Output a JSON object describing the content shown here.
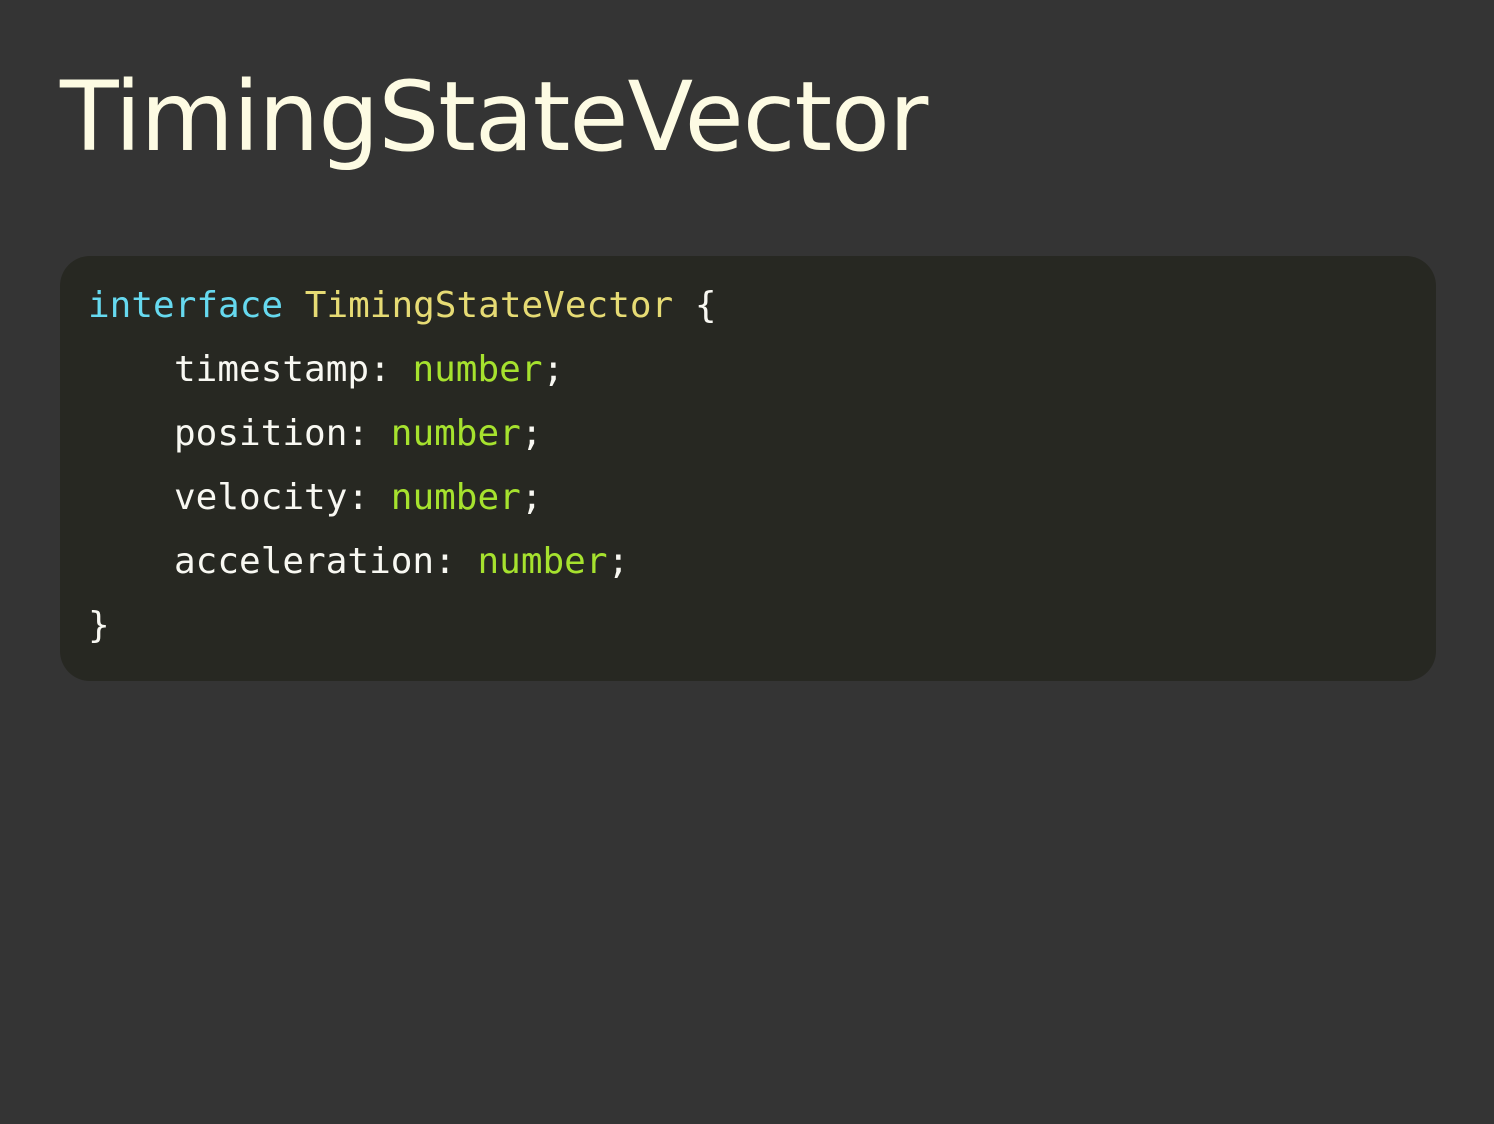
{
  "slide": {
    "title": "TimingStateVector"
  },
  "code": {
    "keyword": "interface",
    "name": "TimingStateVector",
    "open_brace": "{",
    "close_brace": "}",
    "fields": [
      {
        "name": "timestamp",
        "type": "number"
      },
      {
        "name": "position",
        "type": "number"
      },
      {
        "name": "velocity",
        "type": "number"
      },
      {
        "name": "acceleration",
        "type": "number"
      }
    ],
    "colon": ":",
    "semicolon": ";"
  },
  "colors": {
    "background": "#343434",
    "code_background": "#272822",
    "title": "#fdfbe3",
    "keyword": "#66d9ef",
    "class_name": "#e6db74",
    "type": "#a6e22e",
    "plain": "#f8f8f2"
  }
}
